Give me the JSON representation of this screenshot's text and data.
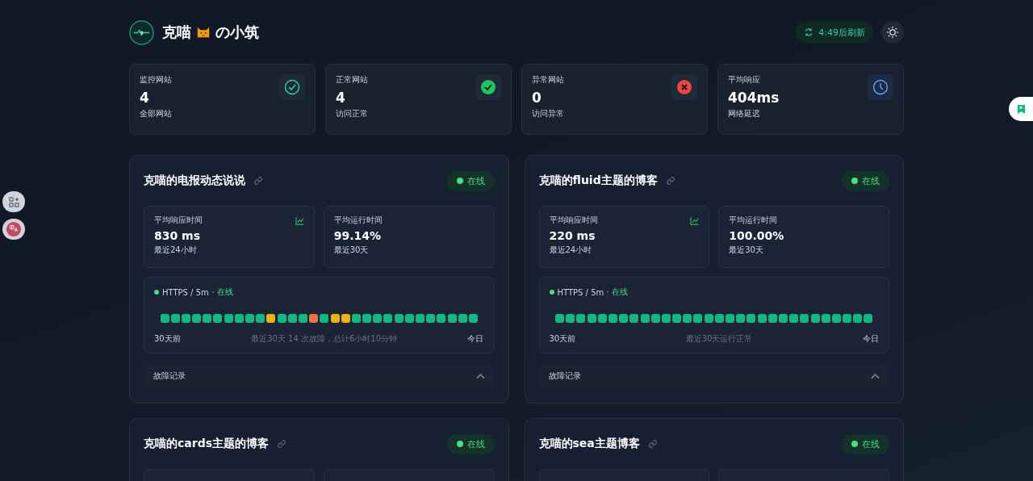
{
  "header": {
    "title": "克喵",
    "title_suffix": "の小筑",
    "refresh": "4:49后刷新"
  },
  "summary": [
    {
      "kind": "all",
      "label": "监控网站",
      "value": "4",
      "note": "全部网站"
    },
    {
      "kind": "ok",
      "label": "正常网站",
      "value": "4",
      "note": "访问正常"
    },
    {
      "kind": "down",
      "label": "异常网站",
      "value": "0",
      "note": "访问异常"
    },
    {
      "kind": "time",
      "label": "平均响应",
      "value": "404ms",
      "note": "网络延迟"
    }
  ],
  "monitors": [
    {
      "name": "克喵的电报动态说说",
      "status": "在线",
      "online": true,
      "stats": [
        {
          "label": "平均响应时间",
          "value": "830 ms",
          "note": "最近24小时",
          "chart": true
        },
        {
          "label": "平均运行时间",
          "value": "99.14%",
          "note": "最近30天",
          "chart": false
        }
      ],
      "protocol": "HTTPS / 5m",
      "protocol_status": "在线",
      "days": [
        {
          "kind": "ok"
        },
        {
          "kind": "ok"
        },
        {
          "kind": "ok"
        },
        {
          "kind": "ok"
        },
        {
          "kind": "ok"
        },
        {
          "kind": "ok"
        },
        {
          "kind": "ok"
        },
        {
          "kind": "ok"
        },
        {
          "kind": "ok"
        },
        {
          "kind": "ok"
        },
        {
          "kind": "warn"
        },
        {
          "kind": "ok"
        },
        {
          "kind": "ok"
        },
        {
          "kind": "ok"
        },
        {
          "kind": "down"
        },
        {
          "kind": "ok"
        },
        {
          "kind": "warn"
        },
        {
          "kind": "warn"
        },
        {
          "kind": "ok"
        },
        {
          "kind": "ok"
        },
        {
          "kind": "ok"
        },
        {
          "kind": "ok"
        },
        {
          "kind": "ok"
        },
        {
          "kind": "ok"
        },
        {
          "kind": "ok"
        },
        {
          "kind": "ok"
        },
        {
          "kind": "ok"
        },
        {
          "kind": "ok"
        },
        {
          "kind": "ok"
        },
        {
          "kind": "ok"
        }
      ],
      "start": "30天前",
      "summary": "最近30天 14 次故障，总计6小时10分钟",
      "end": "今日",
      "log": "故障记录",
      "expanded": true
    },
    {
      "name": "克喵的fluid主题的博客",
      "status": "在线",
      "online": true,
      "stats": [
        {
          "label": "平均响应时间",
          "value": "220 ms",
          "note": "最近24小时",
          "chart": true
        },
        {
          "label": "平均运行时间",
          "value": "100.00%",
          "note": "最近30天",
          "chart": false
        }
      ],
      "protocol": "HTTPS / 5m",
      "protocol_status": "在线",
      "days": [
        {
          "kind": "ok"
        },
        {
          "kind": "ok"
        },
        {
          "kind": "ok"
        },
        {
          "kind": "ok"
        },
        {
          "kind": "ok"
        },
        {
          "kind": "ok"
        },
        {
          "kind": "ok"
        },
        {
          "kind": "ok"
        },
        {
          "kind": "ok"
        },
        {
          "kind": "ok"
        },
        {
          "kind": "ok"
        },
        {
          "kind": "ok"
        },
        {
          "kind": "ok"
        },
        {
          "kind": "ok"
        },
        {
          "kind": "ok"
        },
        {
          "kind": "ok"
        },
        {
          "kind": "ok"
        },
        {
          "kind": "ok"
        },
        {
          "kind": "ok"
        },
        {
          "kind": "ok"
        },
        {
          "kind": "ok"
        },
        {
          "kind": "ok"
        },
        {
          "kind": "ok"
        },
        {
          "kind": "ok"
        },
        {
          "kind": "ok"
        },
        {
          "kind": "ok"
        },
        {
          "kind": "ok"
        },
        {
          "kind": "ok"
        },
        {
          "kind": "ok"
        },
        {
          "kind": "ok"
        }
      ],
      "start": "30天前",
      "summary": "最近30天运行正常",
      "end": "今日",
      "log": "故障记录",
      "expanded": true
    },
    {
      "name": "克喵的cards主题的博客",
      "status": "在线",
      "online": true
    },
    {
      "name": "克喵的sea主题博客",
      "status": "在线",
      "online": true
    }
  ]
}
